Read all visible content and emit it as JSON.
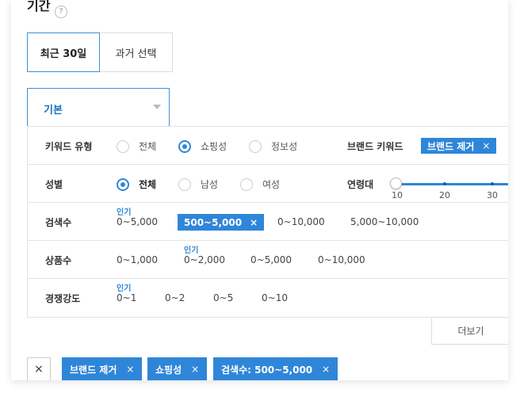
{
  "section": {
    "title": "기간",
    "info_icon": "info-icon"
  },
  "period": {
    "options": [
      "최근 30일",
      "과거 선택"
    ],
    "selected": "최근 30일"
  },
  "select": {
    "value": "기본"
  },
  "keyword_type": {
    "label": "키워드 유형",
    "options": [
      "전체",
      "쇼핑성",
      "정보성"
    ],
    "selected": "쇼핑성"
  },
  "brand_keyword": {
    "label": "브랜드 키워드",
    "chip": "브랜드 제거",
    "remove": "×"
  },
  "gender": {
    "label": "성별",
    "options": [
      "전체",
      "남성",
      "여성"
    ],
    "selected": "전체"
  },
  "age": {
    "label": "연령대",
    "ticks": [
      "10",
      "20",
      "30"
    ],
    "value": 10
  },
  "search_volume": {
    "label": "검색수",
    "options": [
      "0~5,000",
      "500~5,000",
      "0~10,000",
      "5,000~10,000"
    ],
    "selected": "500~5,000",
    "popular": "인기"
  },
  "product_count": {
    "label": "상품수",
    "options": [
      "0~1,000",
      "0~2,000",
      "0~5,000",
      "0~10,000"
    ],
    "popular": "인기"
  },
  "competition": {
    "label": "경쟁강도",
    "options": [
      "0~1",
      "0~2",
      "0~5",
      "0~10"
    ],
    "popular": "인기"
  },
  "more_button": "더보기",
  "applied": {
    "clear": "×",
    "tags": [
      "브랜드 제거",
      "쇼핑성",
      "검색수: 500~5,000"
    ],
    "remove": "×"
  },
  "colors": {
    "accent": "#2f86d8",
    "accent_text": "#1a6fc2",
    "border": "#e3e3e3"
  }
}
